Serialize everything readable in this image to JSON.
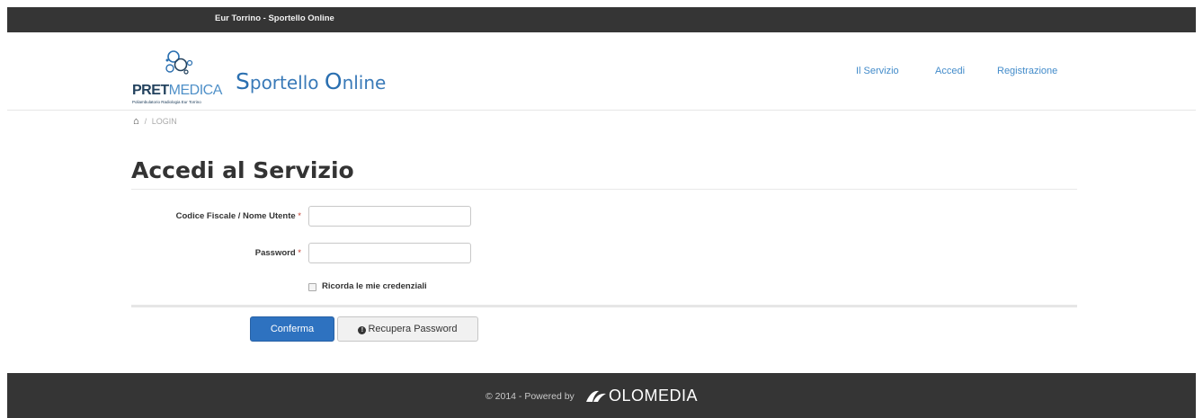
{
  "topbar": {
    "site_name": "Eur Torrino - Sportello Online"
  },
  "header": {
    "logo": {
      "pret": "PRET",
      "medica": "MEDICA",
      "tagline": "Poliambulatorio Radiologia Eur Torrino"
    },
    "brand_s": "S",
    "brand_mid": "portello ",
    "brand_o": "O",
    "brand_end": "nline",
    "nav": [
      {
        "label": "Il Servizio"
      },
      {
        "label": "Accedi"
      },
      {
        "label": "Registrazione"
      }
    ]
  },
  "breadcrumb": {
    "home_icon": "home-icon",
    "separator": "/",
    "current": "LOGIN"
  },
  "page": {
    "title": "Accedi al Servizio"
  },
  "form": {
    "username_label": "Codice Fiscale / Nome Utente",
    "password_label": "Password",
    "required_mark": "*",
    "username_value": "",
    "password_value": "",
    "remember_label": "Ricorda le mie credenziali",
    "submit_label": "Conferma",
    "recover_label": "Recupera Password",
    "recover_icon": "exclamation-circle-icon"
  },
  "footer": {
    "copyright": "© 2014 - Powered by",
    "powered_logo": "OLOMEDIA"
  },
  "colors": {
    "topbar": "#353535",
    "footer": "#353535",
    "link": "#428bca",
    "primary": "#2e72c0",
    "brand": "#3a7ab8"
  }
}
